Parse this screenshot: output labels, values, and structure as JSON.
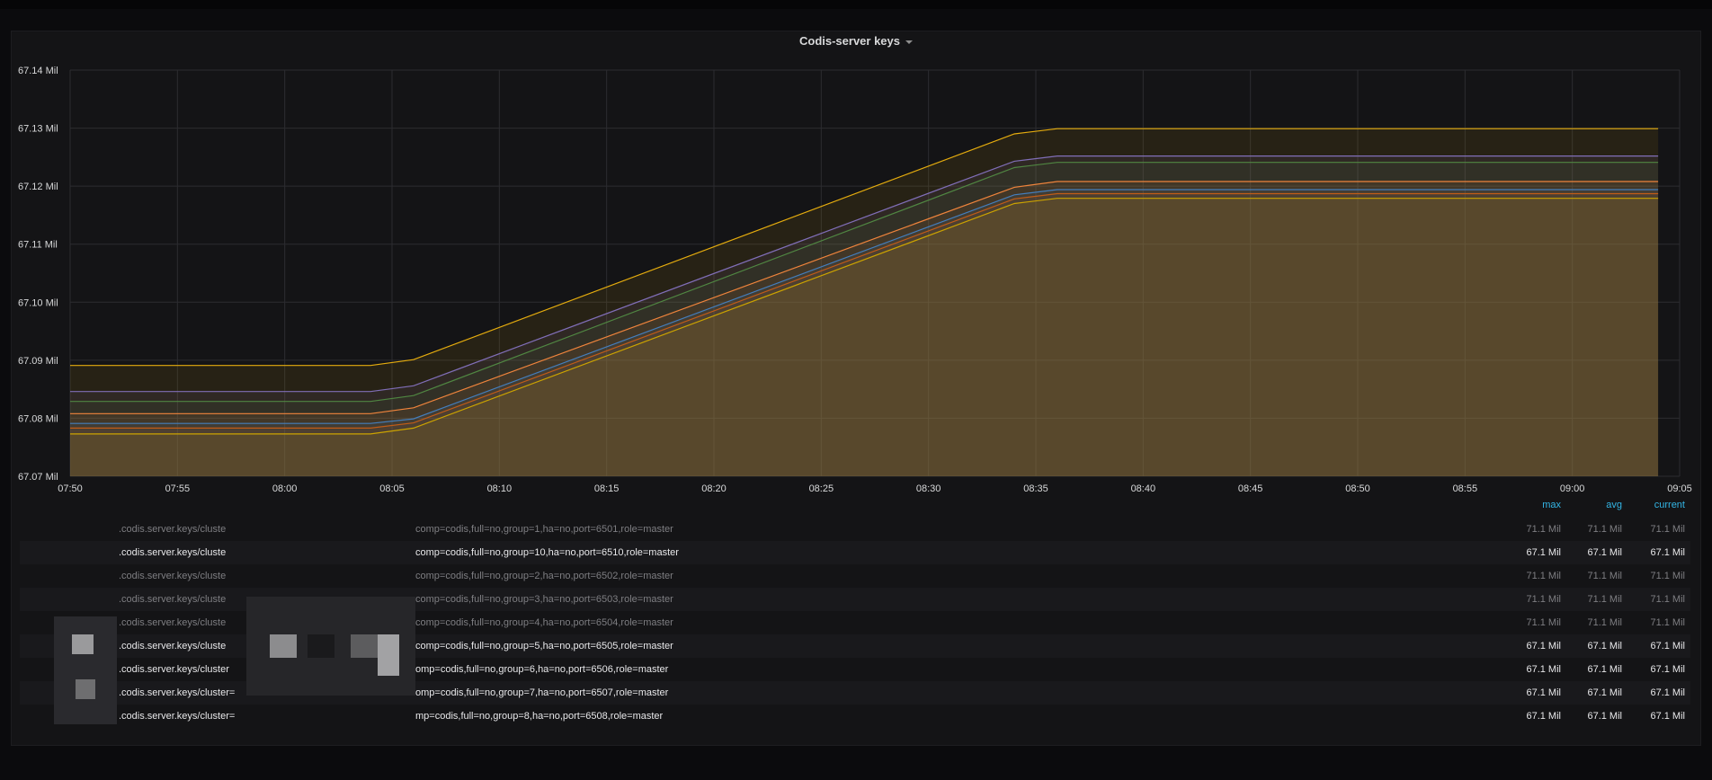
{
  "panel": {
    "title": "Codis-server keys"
  },
  "chart_data": {
    "type": "area",
    "title": "Codis-server keys",
    "xlabel": "",
    "ylabel": "",
    "x_ticks": [
      "07:50",
      "07:55",
      "08:00",
      "08:05",
      "08:10",
      "08:15",
      "08:20",
      "08:25",
      "08:30",
      "08:35",
      "08:40",
      "08:45",
      "08:50",
      "08:55",
      "09:00",
      "09:05"
    ],
    "y_ticks": [
      "67.07 Mil",
      "67.08 Mil",
      "67.09 Mil",
      "67.10 Mil",
      "67.11 Mil",
      "67.12 Mil",
      "67.13 Mil",
      "67.14 Mil"
    ],
    "ylim": [
      67.07,
      67.14
    ],
    "y_unit": "Mil",
    "x_start": "07:50",
    "x_end": "09:05",
    "grid": true,
    "legend_placement": "bottom",
    "x": [
      "07:50",
      "08:04",
      "08:06",
      "08:34",
      "08:36",
      "09:04"
    ],
    "series": [
      {
        "color": "#e5ac0e",
        "values": [
          67.0891,
          67.0891,
          67.0901,
          67.129,
          67.1299,
          67.1299
        ]
      },
      {
        "color": "#806eb7",
        "values": [
          67.0846,
          67.0846,
          67.0856,
          67.1243,
          67.1252,
          67.1252
        ]
      },
      {
        "color": "#508642",
        "values": [
          67.0829,
          67.0829,
          67.0839,
          67.1232,
          67.1241,
          67.1241
        ]
      },
      {
        "color": "#ef843c",
        "values": [
          67.0808,
          67.0808,
          67.0818,
          67.1198,
          67.1208,
          67.1208
        ]
      },
      {
        "color": "#447ebc",
        "values": [
          67.0791,
          67.0791,
          67.0799,
          67.1185,
          67.1194,
          67.1194
        ]
      },
      {
        "color": "#c15c17",
        "values": [
          67.0783,
          67.0783,
          67.0792,
          67.1178,
          67.1187,
          67.1187
        ]
      },
      {
        "color": "#cca300",
        "values": [
          67.0773,
          67.0773,
          67.0783,
          67.117,
          67.1179,
          67.1179
        ]
      }
    ]
  },
  "legend": {
    "headers": {
      "max": "max",
      "avg": "avg",
      "current": "current"
    },
    "rows": [
      {
        "name1": ".codis.server.keys/cluste",
        "name2": "comp=codis,full=no,group=1,ha=no,port=6501,role=master",
        "max": "71.1 Mil",
        "avg": "71.1 Mil",
        "current": "71.1 Mil",
        "state": "dim"
      },
      {
        "name1": ".codis.server.keys/cluste",
        "name2": "comp=codis,full=no,group=10,ha=no,port=6510,role=master",
        "max": "67.1 Mil",
        "avg": "67.1 Mil",
        "current": "67.1 Mil",
        "state": "bright"
      },
      {
        "name1": ".codis.server.keys/cluste",
        "name2": "comp=codis,full=no,group=2,ha=no,port=6502,role=master",
        "max": "71.1 Mil",
        "avg": "71.1 Mil",
        "current": "71.1 Mil",
        "state": "dim"
      },
      {
        "name1": ".codis.server.keys/cluste",
        "name2": "comp=codis,full=no,group=3,ha=no,port=6503,role=master",
        "max": "71.1 Mil",
        "avg": "71.1 Mil",
        "current": "71.1 Mil",
        "state": "dim"
      },
      {
        "name1": ".codis.server.keys/cluste",
        "name2": "comp=codis,full=no,group=4,ha=no,port=6504,role=master",
        "max": "71.1 Mil",
        "avg": "71.1 Mil",
        "current": "71.1 Mil",
        "state": "dim"
      },
      {
        "name1": ".codis.server.keys/cluste",
        "name2": "comp=codis,full=no,group=5,ha=no,port=6505,role=master",
        "max": "67.1 Mil",
        "avg": "67.1 Mil",
        "current": "67.1 Mil",
        "state": "bright"
      },
      {
        "name1": ".codis.server.keys/cluster",
        "name2": "omp=codis,full=no,group=6,ha=no,port=6506,role=master",
        "max": "67.1 Mil",
        "avg": "67.1 Mil",
        "current": "67.1 Mil",
        "state": "bright"
      },
      {
        "name1": ".codis.server.keys/cluster=",
        "name2": "omp=codis,full=no,group=7,ha=no,port=6507,role=master",
        "max": "67.1 Mil",
        "avg": "67.1 Mil",
        "current": "67.1 Mil",
        "state": "bright"
      },
      {
        "name1": ".codis.server.keys/cluster=",
        "name2": "mp=codis,full=no,group=8,ha=no,port=6508,role=master",
        "max": "67.1 Mil",
        "avg": "67.1 Mil",
        "current": "67.1 Mil",
        "state": "bright"
      }
    ]
  }
}
